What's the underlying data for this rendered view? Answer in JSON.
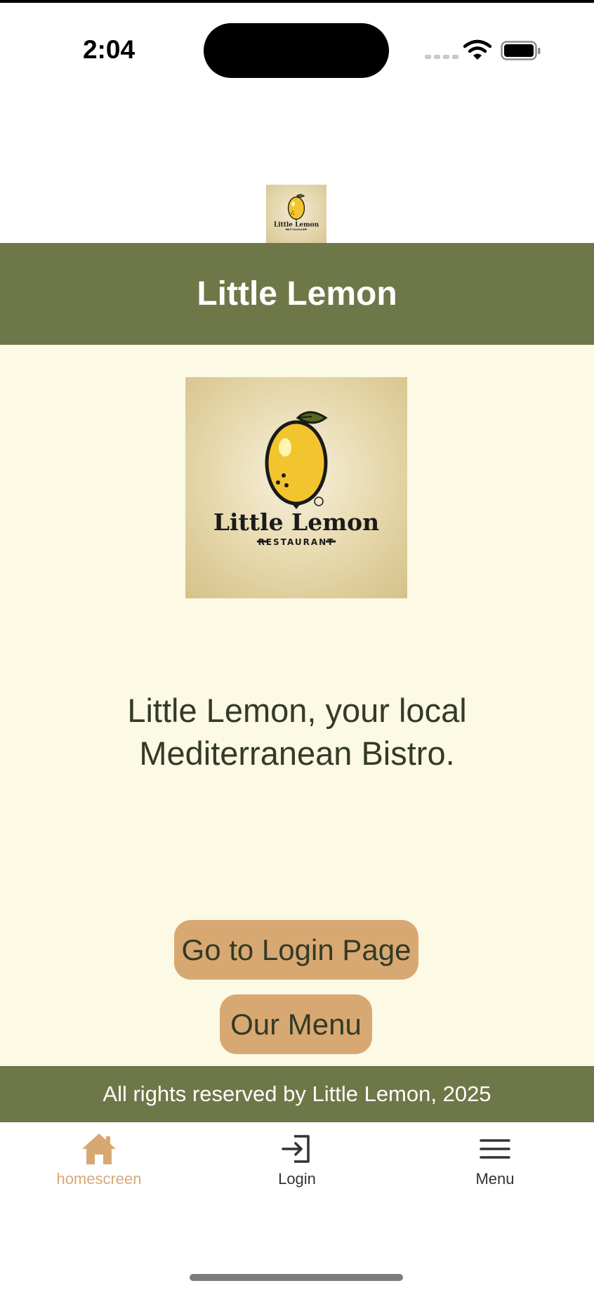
{
  "status_bar": {
    "time": "2:04"
  },
  "header": {
    "title": "Little Lemon"
  },
  "logo": {
    "brand": "Little Lemon",
    "sub": "RESTAURANT"
  },
  "hero": {
    "tagline": "Little Lemon, your local Mediterranean Bistro."
  },
  "buttons": {
    "login_label": "Go to Login Page",
    "menu_label": "Our Menu"
  },
  "footer": {
    "text": "All rights reserved by Little Lemon, 2025"
  },
  "tabs": [
    {
      "label": "homescreen",
      "icon": "home-icon",
      "active": true
    },
    {
      "label": "Login",
      "icon": "login-icon",
      "active": false
    },
    {
      "label": "Menu",
      "icon": "hamburger-menu-icon",
      "active": false
    }
  ],
  "colors": {
    "header_bg": "#6e7747",
    "content_bg": "#fcf9e5",
    "button_bg": "#d8a873",
    "active_tab": "#d8a873",
    "text_dark": "#333b25"
  }
}
